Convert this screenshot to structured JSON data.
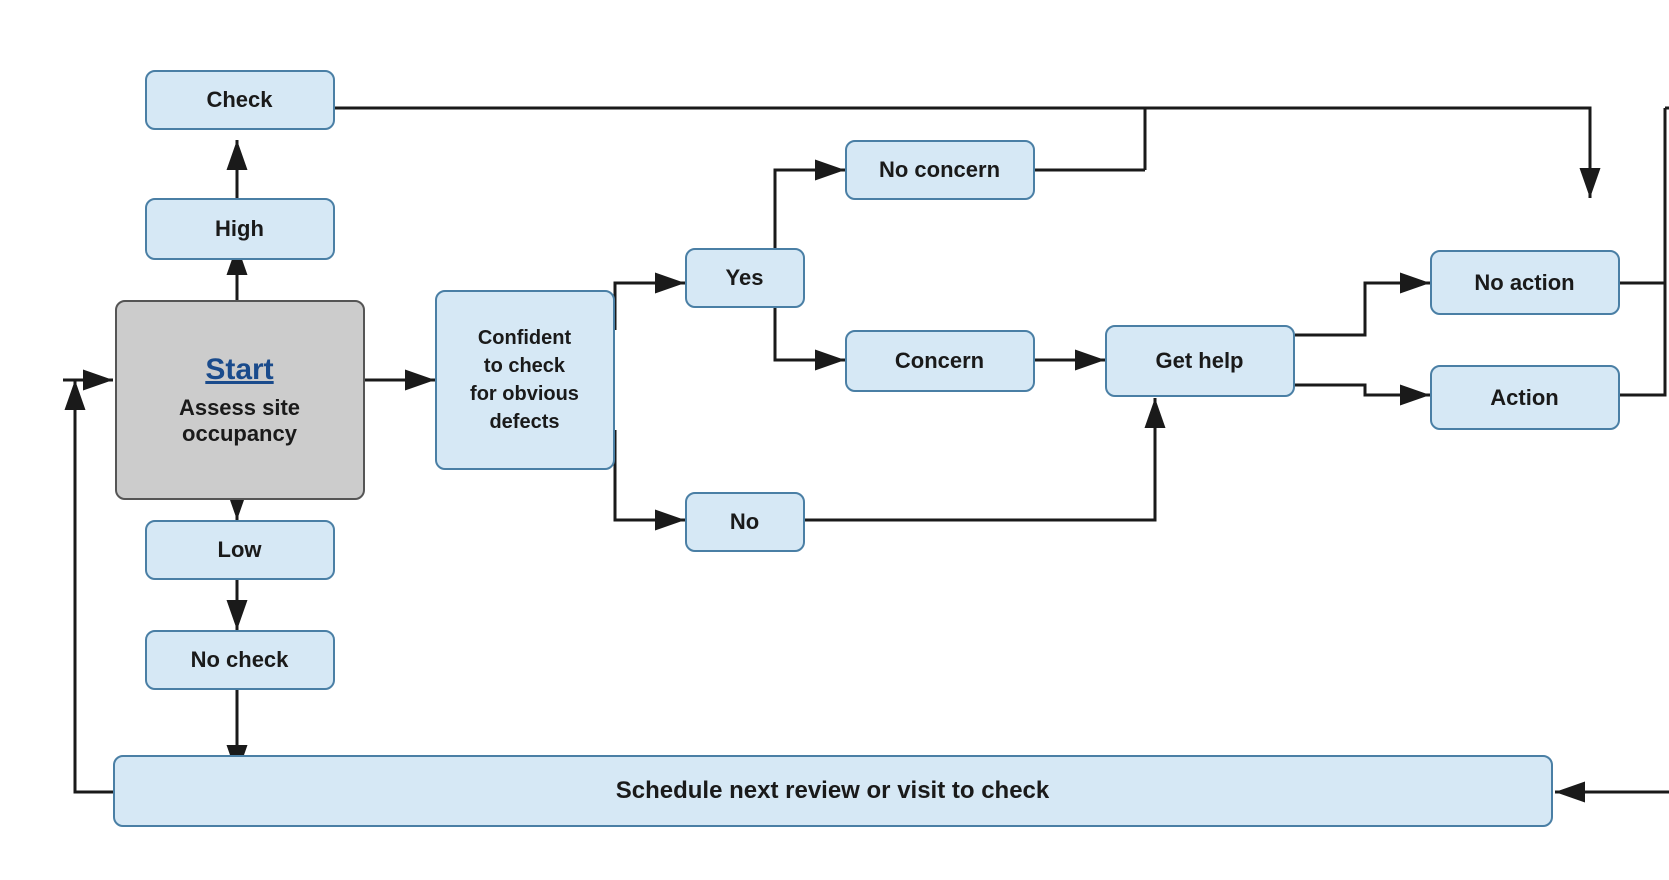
{
  "nodes": {
    "check": {
      "label": "Check"
    },
    "high": {
      "label": "High"
    },
    "start": {
      "title": "Start",
      "subtitle": "Assess site occupancy"
    },
    "low": {
      "label": "Low"
    },
    "no_check": {
      "label": "No check"
    },
    "confident": {
      "label": "Confident\nto check\nfor obvious\ndefects"
    },
    "yes": {
      "label": "Yes"
    },
    "no": {
      "label": "No"
    },
    "no_concern": {
      "label": "No concern"
    },
    "concern": {
      "label": "Concern"
    },
    "get_help": {
      "label": "Get help"
    },
    "no_action": {
      "label": "No action"
    },
    "action": {
      "label": "Action"
    },
    "schedule": {
      "label": "Schedule next review or visit to check"
    }
  }
}
